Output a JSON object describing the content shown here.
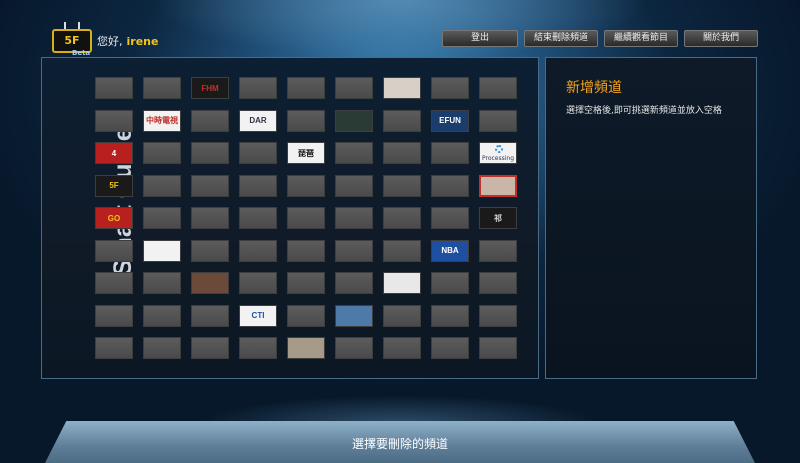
{
  "header": {
    "logo_text": "5F",
    "logo_sub": "Beta",
    "greeting": "您好,",
    "username": "irene",
    "nav": [
      "登出",
      "結束刪除頻道",
      "繼續觀看節目",
      "關於我們"
    ]
  },
  "guide": {
    "title": "Smart Guide",
    "channels": [
      {
        "row": 0,
        "col": 2,
        "label": "FHM",
        "color": "#c0302a",
        "bg": "#1a1a1a"
      },
      {
        "row": 0,
        "col": 6,
        "label": "",
        "color": "#e05a9a",
        "bg": "#d7d0c7"
      },
      {
        "row": 1,
        "col": 1,
        "label": "中時電視",
        "color": "#c0302a",
        "bg": "#f2f2f2"
      },
      {
        "row": 1,
        "col": 3,
        "label": "DAR",
        "color": "#334",
        "bg": "#f2f2f2"
      },
      {
        "row": 1,
        "col": 5,
        "label": "",
        "color": "#666",
        "bg": "#2a3a35"
      },
      {
        "row": 1,
        "col": 7,
        "label": "EFUN",
        "color": "#ffffff",
        "bg": "#1a3d6b"
      },
      {
        "row": 2,
        "col": 0,
        "label": "4",
        "color": "#ffffff",
        "bg": "#b82020"
      },
      {
        "row": 2,
        "col": 4,
        "label": "琵琶",
        "color": "#111",
        "bg": "#f2f2f2"
      },
      {
        "row": 2,
        "col": 8,
        "label": "Processing",
        "color": "#335",
        "bg": "#f2f2f2"
      },
      {
        "row": 3,
        "col": 0,
        "label": "5F",
        "color": "#f0c419",
        "bg": "#1a1a1a"
      },
      {
        "row": 3,
        "col": 8,
        "label": "",
        "color": "#fff",
        "bg": "#c9b6a8",
        "selected": true
      },
      {
        "row": 4,
        "col": 0,
        "label": "GO",
        "color": "#f0c419",
        "bg": "#b82020"
      },
      {
        "row": 4,
        "col": 8,
        "label": "祁",
        "color": "#ddd",
        "bg": "#1a1a1a"
      },
      {
        "row": 5,
        "col": 1,
        "label": "",
        "color": "#c0302a",
        "bg": "#f2f2f2"
      },
      {
        "row": 5,
        "col": 7,
        "label": "NBA",
        "color": "#fff",
        "bg": "#1e4fa0"
      },
      {
        "row": 6,
        "col": 2,
        "label": "",
        "color": "#fff",
        "bg": "#6b4a3a"
      },
      {
        "row": 6,
        "col": 6,
        "label": "",
        "color": "#222",
        "bg": "#e8e8e8"
      },
      {
        "row": 7,
        "col": 3,
        "label": "CTI",
        "color": "#1e4fa0",
        "bg": "#f2f2f2"
      },
      {
        "row": 7,
        "col": 5,
        "label": "",
        "color": "#fff",
        "bg": "#4d7aa8"
      },
      {
        "row": 8,
        "col": 4,
        "label": "",
        "color": "#fff",
        "bg": "#a69a88"
      }
    ]
  },
  "panel": {
    "title": "新增頻道",
    "text": "選擇空格後,即可挑選新頻道並放入空格"
  },
  "footer": {
    "text": "選擇要刪除的頻道"
  },
  "colors": {
    "accent": "#f5a31a",
    "username": "#f0c419"
  }
}
